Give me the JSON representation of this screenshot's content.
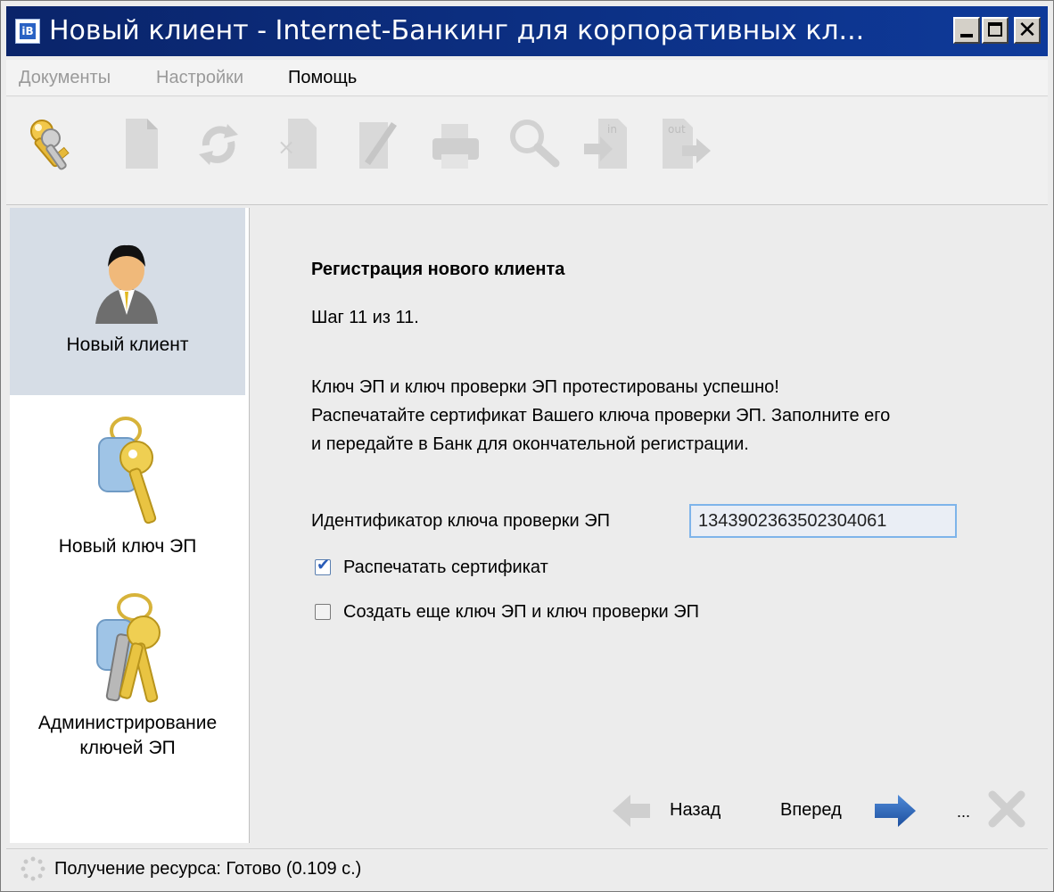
{
  "window": {
    "title": "Новый клиент - Internet-Банкинг для корпоративных кл...",
    "controls": [
      "minimize",
      "maximize",
      "close"
    ]
  },
  "menu": [
    {
      "label": "Документы",
      "enabled": false
    },
    {
      "label": "Настройки",
      "enabled": false
    },
    {
      "label": "Помощь",
      "enabled": true
    }
  ],
  "toolbar": {
    "buttons": [
      {
        "icon": "keys-icon",
        "enabled": true
      },
      {
        "icon": "new-document-icon",
        "enabled": false
      },
      {
        "icon": "refresh-icon",
        "enabled": false
      },
      {
        "icon": "delete-document-icon",
        "enabled": false
      },
      {
        "icon": "edit-document-icon",
        "enabled": false
      },
      {
        "icon": "print-icon",
        "enabled": false
      },
      {
        "icon": "search-icon",
        "enabled": false
      },
      {
        "icon": "import-icon",
        "label": "in",
        "enabled": false
      },
      {
        "icon": "export-icon",
        "label": "out",
        "enabled": false
      }
    ]
  },
  "nav": {
    "items": [
      {
        "label": "Новый клиент",
        "icon": "user-icon",
        "active": true
      },
      {
        "label": "Новый ключ ЭП",
        "icon": "key-icon",
        "active": false
      },
      {
        "label_lines": [
          "Администрирование",
          "ключей ЭП"
        ],
        "icon": "keys-admin-icon",
        "active": false
      }
    ]
  },
  "wizard": {
    "heading": "Регистрация нового клиента",
    "step": "Шаг 11 из 11.",
    "message_lines": [
      "Ключ ЭП и ключ проверки ЭП протестированы успешно!",
      "Распечатайте сертификат Вашего ключа проверки ЭП. Заполните его",
      "и передайте в Банк для окончательной регистрации."
    ],
    "id_label": "Идентификатор ключа проверки ЭП",
    "id_value": "1343902363502304061",
    "print_certificate": {
      "label": "Распечатать сертификат",
      "checked": true
    },
    "create_another": {
      "label": "Создать еще ключ ЭП и ключ проверки ЭП",
      "checked": false
    },
    "back_label": "Назад",
    "next_label": "Вперед",
    "ellipsis": "..."
  },
  "status": {
    "text": "Получение ресурса: Готово (0.109 с.)"
  }
}
